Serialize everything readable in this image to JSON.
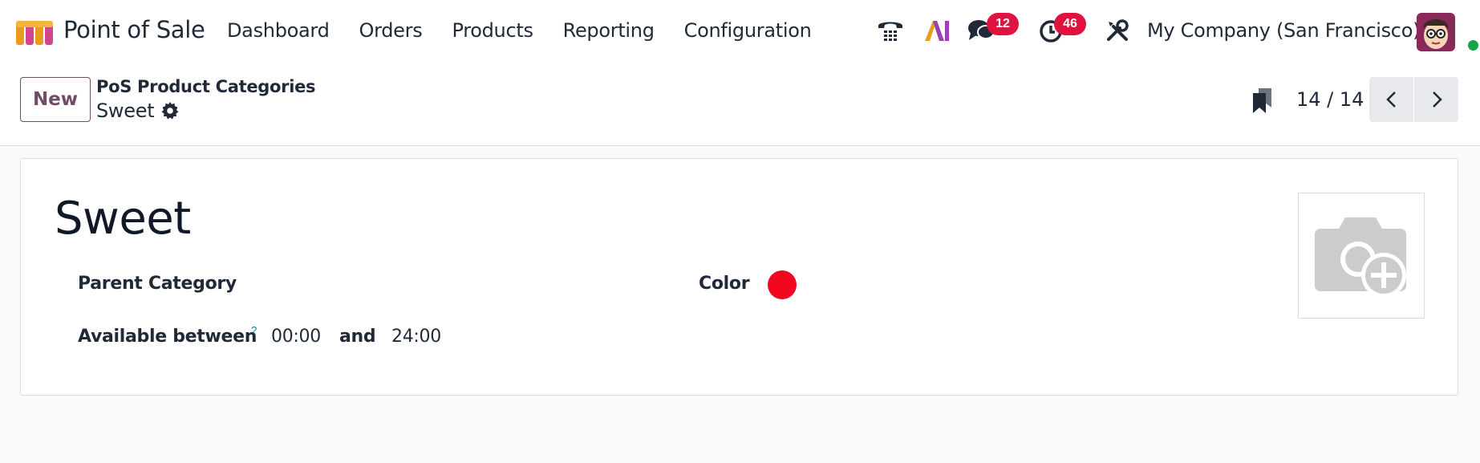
{
  "navbar": {
    "app_name": "Point of Sale",
    "menu": [
      "Dashboard",
      "Orders",
      "Products",
      "Reporting",
      "Configuration"
    ],
    "messages_count": "12",
    "activities_count": "46",
    "company": "My Company (San Francisco)",
    "icons": [
      "app-logo",
      "phone-icon",
      "ai-icon",
      "chat-icon",
      "clock-icon",
      "tools-icon",
      "avatar"
    ]
  },
  "control": {
    "new_label": "New",
    "breadcrumb_parent": "PoS Product Categories",
    "breadcrumb_current": "Sweet",
    "pager": "14 / 14"
  },
  "form": {
    "title": "Sweet",
    "parent_category_label": "Parent Category",
    "parent_category_value": "",
    "color_label": "Color",
    "color_value": "#f0061d",
    "available_label": "Available between",
    "help_mark": "?",
    "available_from": "00:00",
    "and_label": "and",
    "available_to": "24:00"
  },
  "colors": {
    "brand": "#714b67",
    "badge": "#e0123f",
    "status_online": "#16a34a"
  }
}
